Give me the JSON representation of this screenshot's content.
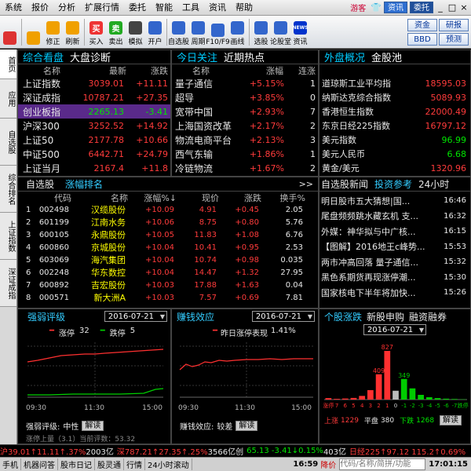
{
  "menu": [
    "系统",
    "报价",
    "分析",
    "扩展行情",
    "委托",
    "智能",
    "工具",
    "资讯",
    "帮助"
  ],
  "menu_right": {
    "guest": "游客",
    "btn1": "资讯",
    "btn2": "委托"
  },
  "toolbar": [
    {
      "label": "",
      "icon": "grid-icon",
      "color": "#d33"
    },
    {
      "label": "",
      "icon": "back-arrow-icon",
      "color": "#f0a000"
    },
    {
      "label": "修正",
      "icon": "up-arrow-icon",
      "color": "#f0a000"
    },
    {
      "label": "刷新",
      "icon": "down-arrow-icon",
      "color": "#f0a000"
    },
    {
      "label": "买入",
      "icon": "buy-icon",
      "text": "买",
      "color": "#e33"
    },
    {
      "label": "卖出",
      "icon": "sell-icon",
      "text": "卖",
      "color": "#2a2"
    },
    {
      "label": "模拟",
      "icon": "simulate-icon",
      "color": "#444"
    },
    {
      "label": "开户",
      "icon": "account-icon",
      "color": "#36c"
    },
    {
      "label": "自选股",
      "icon": "watchlist-icon",
      "color": "#36c"
    },
    {
      "label": "周期",
      "icon": "period-icon",
      "color": "#36c"
    },
    {
      "label": "F10/F9",
      "icon": "f10-icon",
      "color": "#36c"
    },
    {
      "label": "画线",
      "icon": "draw-icon",
      "color": "#36c"
    },
    {
      "label": "选股",
      "icon": "screener-icon",
      "color": "#36c"
    },
    {
      "label": "论股堂",
      "icon": "forum-icon",
      "color": "#36c"
    },
    {
      "label": "资讯",
      "icon": "news-icon",
      "text": "NEWS",
      "color": "#03c"
    }
  ],
  "toolbar_right": [
    "资金",
    "研报",
    "BBD",
    "预测"
  ],
  "side_tabs": [
    "首页",
    "应用",
    "自选股",
    "综合排名",
    "上证指数",
    "深证成指"
  ],
  "colors": {
    "red": "#ff3b3b",
    "green": "#00e600",
    "cyan": "#33ccff",
    "yellow": "#ffff00"
  },
  "p1": {
    "tab1": "综合看盘",
    "tab2": "大盘诊断",
    "cols": [
      "名称",
      "最新",
      "涨跌"
    ],
    "rows": [
      {
        "name": "上证指数",
        "price": "3039.01",
        "chg": "+11.11",
        "dir": "up"
      },
      {
        "name": "深证成指",
        "price": "10787.21",
        "chg": "+27.35",
        "dir": "up"
      },
      {
        "name": "创业板指",
        "price": "2265.13",
        "chg": "-3.41",
        "dir": "down",
        "hl": true
      },
      {
        "name": "沪深300",
        "price": "3252.52",
        "chg": "+14.92",
        "dir": "up"
      },
      {
        "name": "上证50",
        "price": "2177.78",
        "chg": "+10.66",
        "dir": "up"
      },
      {
        "name": "中证500",
        "price": "6442.71",
        "chg": "+24.79",
        "dir": "up"
      },
      {
        "name": "上证当月",
        "price": "2167.4",
        "chg": "+11.8",
        "dir": "up"
      }
    ]
  },
  "p2": {
    "tab1": "今日关注",
    "tab2": "近期热点",
    "cols": [
      "名称",
      "涨幅",
      "连涨"
    ],
    "rows": [
      {
        "name": "量子通信",
        "pct": "+5.15%",
        "days": "1"
      },
      {
        "name": "超导",
        "pct": "+3.85%",
        "days": "0"
      },
      {
        "name": "宽带中国",
        "pct": "+2.93%",
        "days": "7"
      },
      {
        "name": "上海国资改革",
        "pct": "+2.17%",
        "days": "2"
      },
      {
        "name": "物流电商平台",
        "pct": "+2.13%",
        "days": "3"
      },
      {
        "name": "西气东输",
        "pct": "+1.86%",
        "days": "1"
      },
      {
        "name": "冷链物流",
        "pct": "+1.67%",
        "days": "2"
      }
    ]
  },
  "p3": {
    "tab1": "外盘概况",
    "tab2": "金股池",
    "rows": [
      {
        "name": "道琼斯工业平均指",
        "price": "18595.03",
        "dir": "up"
      },
      {
        "name": "纳斯达克综合指数",
        "price": "5089.93",
        "dir": "up"
      },
      {
        "name": "香港恒生指数",
        "price": "22000.49",
        "dir": "up"
      },
      {
        "name": "东京日经225指数",
        "price": "16797.12",
        "dir": "up"
      },
      {
        "name": "美元指数",
        "price": "96.99",
        "dir": "down"
      },
      {
        "name": "美元人民币",
        "price": "6.68",
        "dir": "down"
      },
      {
        "name": "黄金/美元",
        "price": "1320.96",
        "dir": "up"
      }
    ]
  },
  "p4": {
    "tab1": "自选股",
    "tab2": "涨幅排名",
    "arrows": ">>",
    "cols": [
      "代码",
      "名称",
      "涨幅%↓",
      "现价",
      "涨跌",
      "换手%"
    ],
    "rows": [
      {
        "n": "1",
        "code": "002498",
        "name": "汉缆股份",
        "pct": "+10.09",
        "price": "4.91",
        "chg": "+0.45",
        "turn": "2.05"
      },
      {
        "n": "2",
        "code": "601199",
        "name": "江南水务",
        "pct": "+10.06",
        "price": "8.75",
        "chg": "+0.80",
        "turn": "5.76"
      },
      {
        "n": "3",
        "code": "600105",
        "name": "永鼎股份",
        "pct": "+10.05",
        "price": "11.83",
        "chg": "+1.08",
        "turn": "6.76"
      },
      {
        "n": "4",
        "code": "600860",
        "name": "京城股份",
        "pct": "+10.04",
        "price": "10.41",
        "chg": "+0.95",
        "turn": "2.53"
      },
      {
        "n": "5",
        "code": "603069",
        "name": "海汽集团",
        "pct": "+10.04",
        "price": "10.74",
        "chg": "+0.98",
        "turn": "0.035"
      },
      {
        "n": "6",
        "code": "002248",
        "name": "华东数控",
        "pct": "+10.04",
        "price": "14.47",
        "chg": "+1.32",
        "turn": "27.95"
      },
      {
        "n": "7",
        "code": "600892",
        "name": "吉宏股份",
        "pct": "+10.03",
        "price": "17.88",
        "chg": "+1.63",
        "turn": "0.04"
      },
      {
        "n": "8",
        "code": "000571",
        "name": "新大洲A",
        "pct": "+10.03",
        "price": "7.57",
        "chg": "+0.69",
        "turn": "7.81"
      }
    ]
  },
  "p5": {
    "tab1": "自选股新闻",
    "tab2": "投资参考",
    "tab3": "24小时",
    "rows": [
      {
        "title": "明日股市五大猜想|国...",
        "time": "16:46"
      },
      {
        "title": "尾盘频频跳水藏玄机 支...",
        "time": "16:32"
      },
      {
        "title": "外媒：神华拟与中广核...",
        "time": "16:15"
      },
      {
        "title": "【图解】2016地王c峰势...",
        "time": "15:53"
      },
      {
        "title": "两市冲高回落 量子通信...",
        "time": "15:32"
      },
      {
        "title": "黑色系期货再现涨停潮...",
        "time": "15:30"
      },
      {
        "title": "国家核电下半年将加快...",
        "time": "15:26"
      }
    ]
  },
  "p6": {
    "title": "强弱评级",
    "date": "2016-07-21",
    "legend_up": "涨停",
    "up_count": "32",
    "legend_down": "跌停",
    "down_count": "5",
    "x_ticks": [
      "09:30",
      "11:30",
      "15:00"
    ],
    "rating_label": "强弱评级:",
    "rating": "中性",
    "btn": "解读",
    "footer": "涨停上量（3.1）当前评数：53.32"
  },
  "p7": {
    "title": "赚钱效应",
    "date": "2016-07-21",
    "legend": "昨日涨停表现",
    "legend_val": "1.41%",
    "x_ticks": [
      "09:30",
      "11:30",
      "15:00"
    ],
    "effect_label": "赚钱效应:",
    "effect": "较差",
    "btn": "解读"
  },
  "p8": {
    "tab1": "个股涨跌",
    "tab2": "新股申购",
    "tab3": "融资融券",
    "date": "2016-07-21",
    "chart_data": {
      "type": "bar",
      "categories": [
        "涨停",
        "7",
        "6",
        "5",
        "4",
        "3",
        "2",
        "1",
        "0",
        "-1",
        "-2",
        "-3",
        "-4",
        "-5",
        "-6",
        "-7",
        "跌停"
      ],
      "values": [
        25,
        12,
        18,
        28,
        62,
        160,
        430,
        827,
        150,
        350,
        190,
        80,
        40,
        25,
        15,
        10,
        5
      ],
      "labels": [
        {
          "idx": 6,
          "text": "409"
        },
        {
          "idx": 7,
          "text": "827"
        },
        {
          "idx": 9,
          "text": "349"
        }
      ]
    },
    "up_label": "上涨",
    "up_val": "1229",
    "flat_label": "平盘",
    "flat_val": "380",
    "down_label": "下跌",
    "down_val": "1268",
    "btn": "解读"
  },
  "status": {
    "sh": "沪39.01↑11.11↑.37%",
    "sh_amt": "2003亿",
    "sz": "深787.21↑27.35↑.25%",
    "sz_amt": "3566亿创",
    "cy": "65.13 -3.41↓0.15%",
    "cy_amt": "403亿",
    "nk": "日经225↑97.12 115.2↑0.69%"
  },
  "bottom": {
    "tabs": [
      "手机",
      "机器问答",
      "股市日记",
      "股灵通",
      "行情",
      "24小时滚动"
    ],
    "time1": "16:59",
    "alert": "降价",
    "input": "代码/名称/简拼/功能",
    "time2": "17:01:15"
  }
}
